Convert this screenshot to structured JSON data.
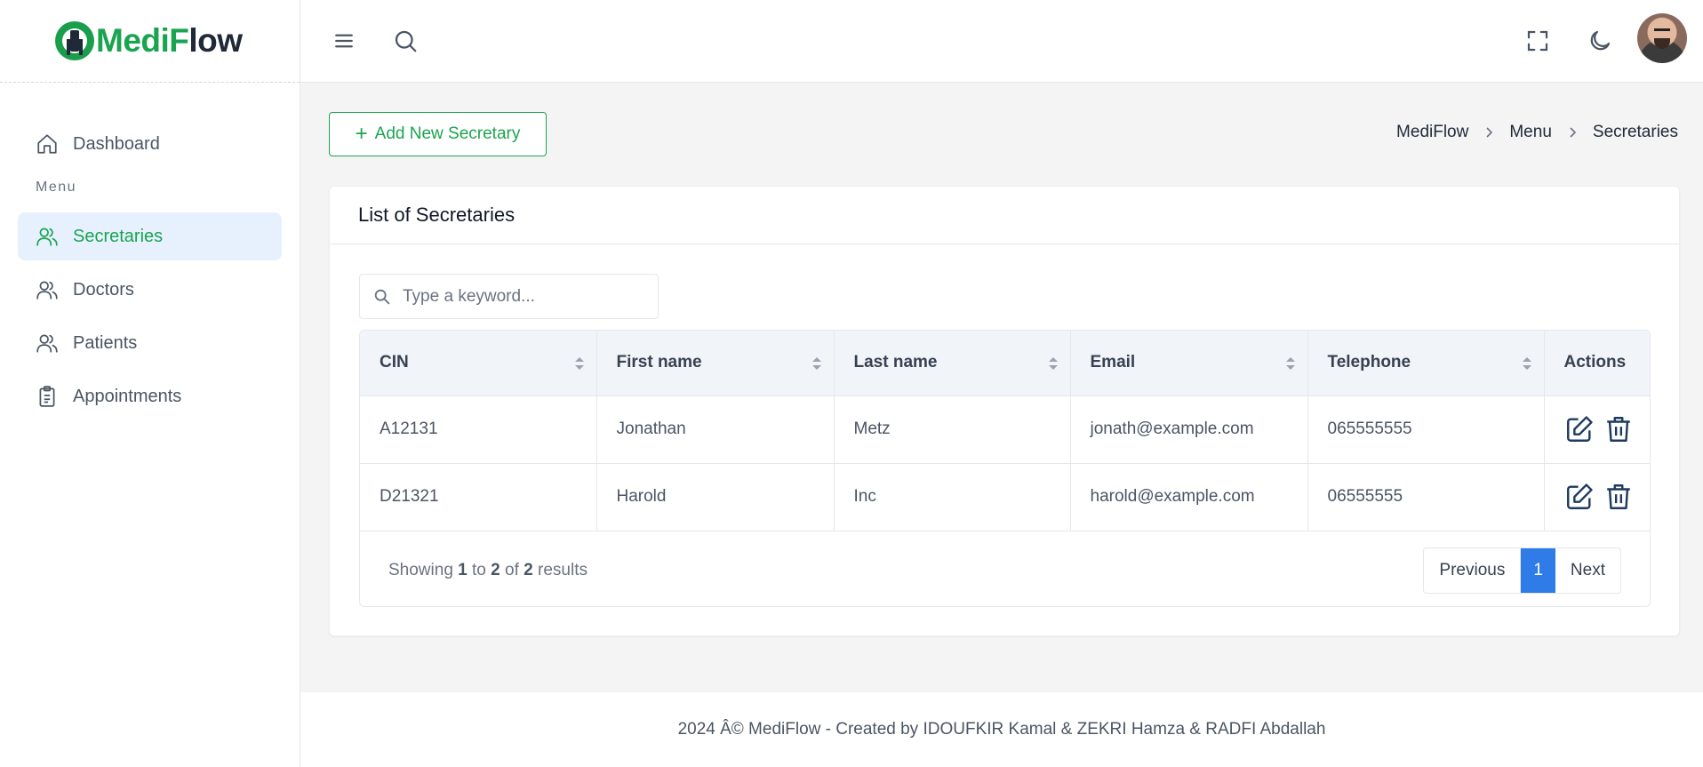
{
  "brand": {
    "part1": "Medi",
    "highlight": "F",
    "part2": "low"
  },
  "sidebar": {
    "items": [
      {
        "label": "Dashboard",
        "icon": "home-icon"
      },
      {
        "label": "Secretaries",
        "icon": "users-icon"
      },
      {
        "label": "Doctors",
        "icon": "users-icon"
      },
      {
        "label": "Patients",
        "icon": "users-icon"
      },
      {
        "label": "Appointments",
        "icon": "clipboard-icon"
      }
    ],
    "menu_label": "Menu",
    "active": "Secretaries"
  },
  "header": {
    "icons": [
      "menu-icon",
      "search-icon",
      "fullscreen-icon",
      "moon-icon",
      "avatar"
    ]
  },
  "toolbar": {
    "add_label": "Add New Secretary",
    "add_icon": "+"
  },
  "breadcrumb": [
    "MediFlow",
    "Menu",
    "Secretaries"
  ],
  "card": {
    "title": "List of Secretaries"
  },
  "search": {
    "placeholder": "Type a keyword..."
  },
  "table": {
    "columns": [
      "CIN",
      "First name",
      "Last name",
      "Email",
      "Telephone",
      "Actions"
    ],
    "rows": [
      [
        "A12131",
        "Jonathan",
        "Metz",
        "jonath@example.com",
        "065555555"
      ],
      [
        "D21321",
        "Harold",
        "Inc",
        "harold@example.com",
        "06555555"
      ]
    ]
  },
  "pagination": {
    "showing_prefix": "Showing",
    "from": "1",
    "to_word": "to",
    "to": "2",
    "of_word": "of",
    "total": "2",
    "suffix": "results",
    "previous": "Previous",
    "current": "1",
    "next": "Next"
  },
  "footer": "2024 Â© MediFlow - Created by IDOUFKIR Kamal & ZEKRI Hamza & RADFI Abdallah",
  "colors": {
    "accent": "#1aa44f",
    "primary": "#2f7be8",
    "active_bg": "#e7f1fe",
    "edit": "#1e3a5f"
  }
}
